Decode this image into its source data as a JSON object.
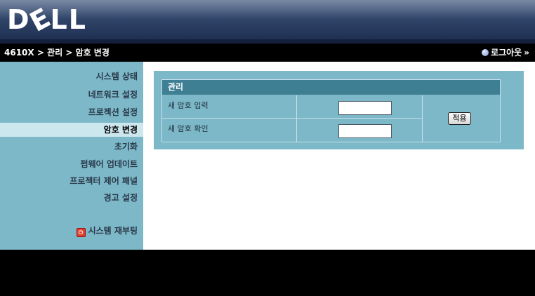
{
  "header": {
    "logo_text": "DELL"
  },
  "navbar": {
    "breadcrumb": "4610X > 관리 > 암호 변경",
    "logout_label": "로그아웃",
    "logout_arrows": "»"
  },
  "sidebar": {
    "items": [
      {
        "label": "시스템 상태",
        "active": false
      },
      {
        "label": "네트워크 설정",
        "active": false
      },
      {
        "label": "프로젝션 설정",
        "active": false
      },
      {
        "label": "암호 변경",
        "active": true
      },
      {
        "label": "초기화",
        "active": false
      },
      {
        "label": "펌웨어 업데이트",
        "active": false
      },
      {
        "label": "프로젝터 제어 패널",
        "active": false
      },
      {
        "label": "경고 설정",
        "active": false
      }
    ],
    "reboot_label": "시스템 재부팅"
  },
  "panel": {
    "title": "관리",
    "rows": [
      {
        "label": "새 암호 입력",
        "value": ""
      },
      {
        "label": "새 암호 확인",
        "value": ""
      }
    ],
    "apply_label": "적용"
  },
  "colors": {
    "sidebar_bg": "#7db8c9",
    "active_item_bg": "#cde7ef",
    "panel_title_bg": "#3f7f93",
    "header_top": "#5a6f90",
    "header_bottom": "#1c2c4e"
  }
}
